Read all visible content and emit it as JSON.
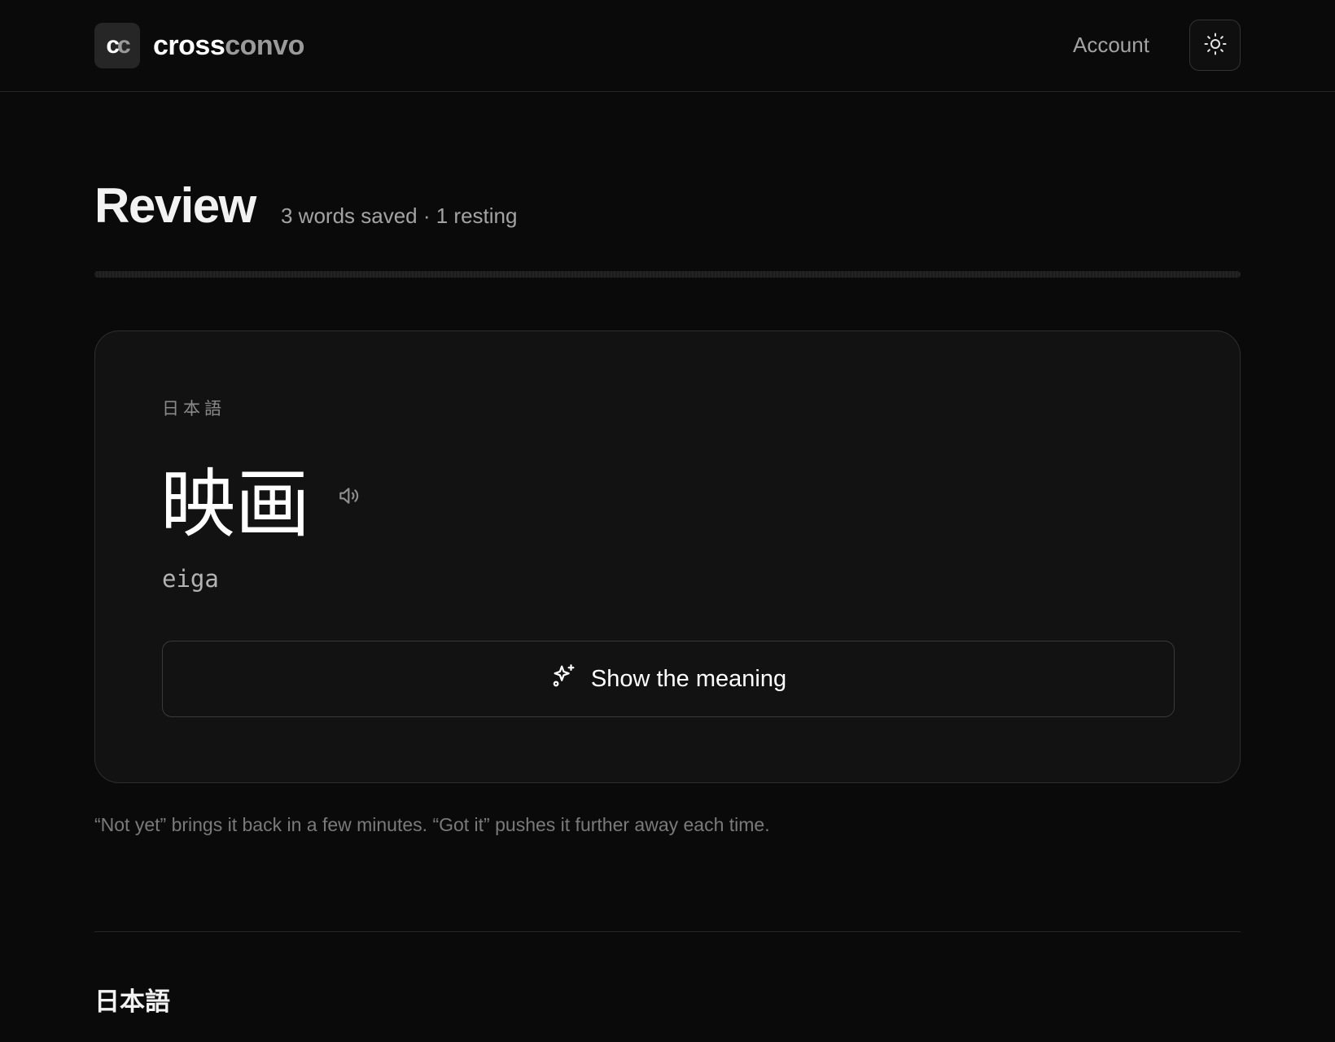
{
  "header": {
    "logo_left": "c",
    "logo_right": "c",
    "brand_left": "cross",
    "brand_right": "convo",
    "account_label": "Account",
    "theme_icon": "sun-icon"
  },
  "review": {
    "title": "Review",
    "subtitle": "3 words saved · 1 resting",
    "progress": 0
  },
  "card": {
    "language": "日本語",
    "word": "映画",
    "romaji": "eiga",
    "speaker_icon": "speaker-icon",
    "show_button_icon": "sparkles-icon",
    "show_button_label": "Show the meaning"
  },
  "hint": "“Not yet” brings it back in a few minutes. “Got it” pushes it further away each time.",
  "section": {
    "language": "日本語"
  },
  "colors": {
    "background": "#0a0a0a",
    "card": "#121212",
    "muted_text": "#a3a3a3"
  }
}
